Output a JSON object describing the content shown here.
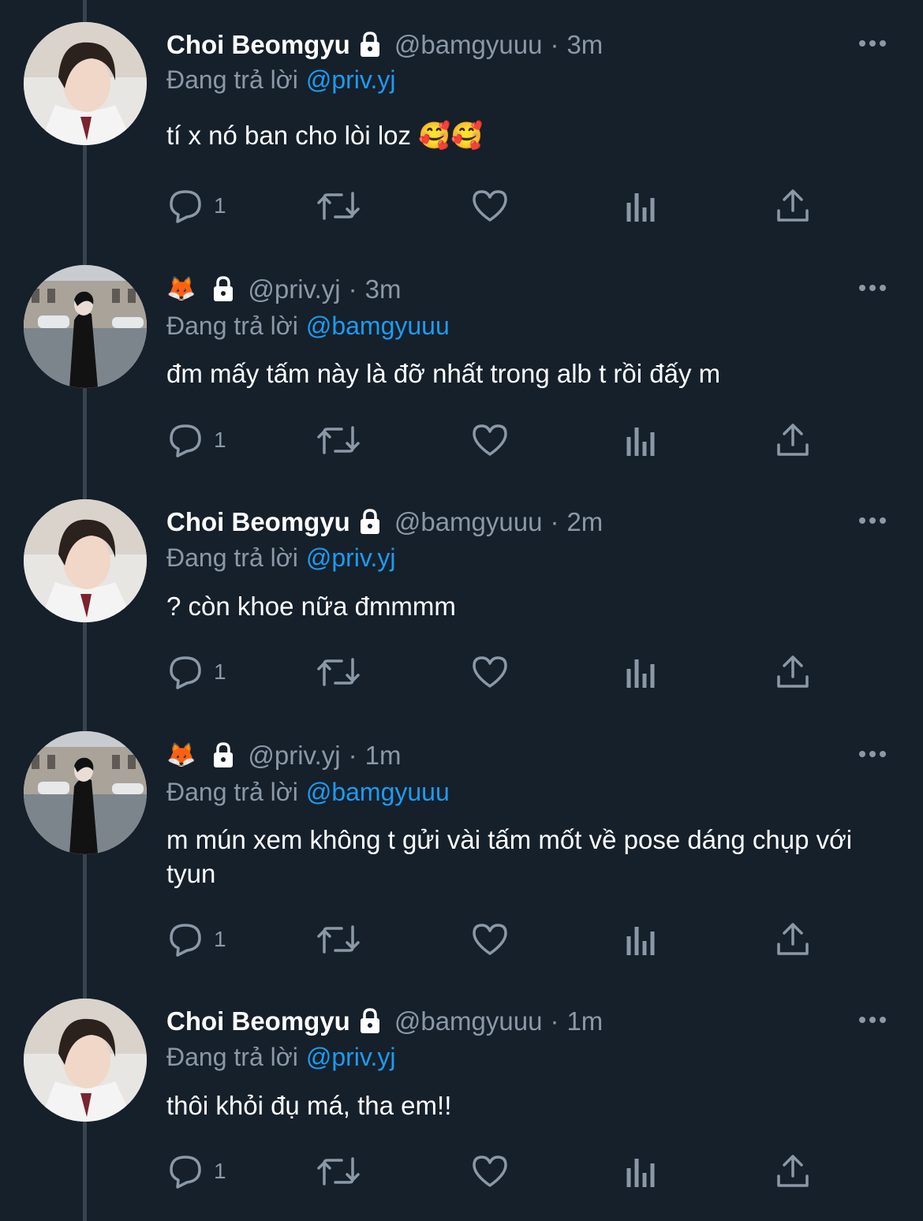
{
  "tweets": [
    {
      "display_name": "Choi Beomgyu",
      "handle": "@bamgyuuu",
      "time": "3m",
      "reply_prefix": "Đang trả lời",
      "reply_to": "@priv.yj",
      "text": "tí x nó ban cho lòi loz 🥰🥰",
      "reply_count": "1",
      "avatar": "boy-portrait-avatar"
    },
    {
      "display_name": "🦊",
      "handle": "@priv.yj",
      "time": "3m",
      "reply_prefix": "Đang trả lời",
      "reply_to": "@bamgyuuu",
      "text": "đm mấy tấm này là đỡ nhất trong alb t rồi đấy m",
      "reply_count": "1",
      "avatar": "street-photo-avatar"
    },
    {
      "display_name": "Choi Beomgyu",
      "handle": "@bamgyuuu",
      "time": "2m",
      "reply_prefix": "Đang trả lời",
      "reply_to": "@priv.yj",
      "text": "? còn khoe nữa đmmmm",
      "reply_count": "1",
      "avatar": "boy-portrait-avatar"
    },
    {
      "display_name": "🦊",
      "handle": "@priv.yj",
      "time": "1m",
      "reply_prefix": "Đang trả lời",
      "reply_to": "@bamgyuuu",
      "text": "m mún xem không t gửi vài tấm mốt về pose dáng chụp với tyun",
      "reply_count": "1",
      "avatar": "street-photo-avatar"
    },
    {
      "display_name": "Choi Beomgyu",
      "handle": "@bamgyuuu",
      "time": "1m",
      "reply_prefix": "Đang trả lời",
      "reply_to": "@priv.yj",
      "text": "thôi khỏi đụ má, tha em!!",
      "reply_count": "1",
      "avatar": "boy-portrait-avatar"
    }
  ],
  "colors": {
    "background": "#15202b",
    "secondary_text": "#8b98a5",
    "link": "#1d9bf0",
    "thread_line": "#38444d"
  }
}
